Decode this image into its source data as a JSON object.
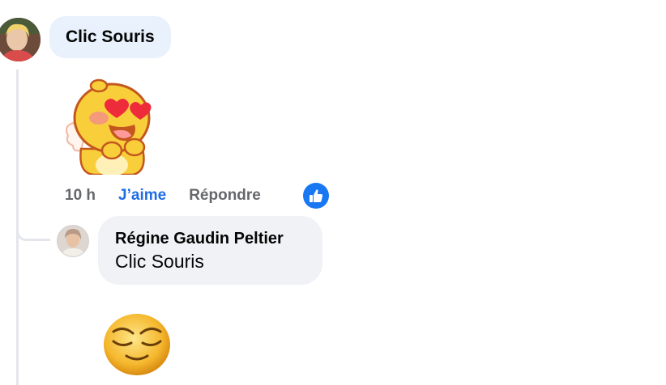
{
  "comment": {
    "author": "Clic Souris",
    "avatar_icon": "user-avatar",
    "attachment_icon": "heart-eyes-sticker",
    "actions": {
      "time": "10 h",
      "like": "J’aime",
      "reply": "Répondre"
    },
    "reaction_icon": "thumbs-up-icon",
    "colors": {
      "like_blue": "#1f6ce7",
      "reaction_bg": "#1877f2",
      "bubble_bg": "#e8f1fc"
    }
  },
  "reply": {
    "author": "Régine Gaudin Peltier",
    "text": "Clic Souris",
    "avatar_icon": "user-avatar",
    "attachment_icon": "relieved-face-emoji",
    "colors": {
      "bubble_bg": "#f0f2f5"
    }
  }
}
